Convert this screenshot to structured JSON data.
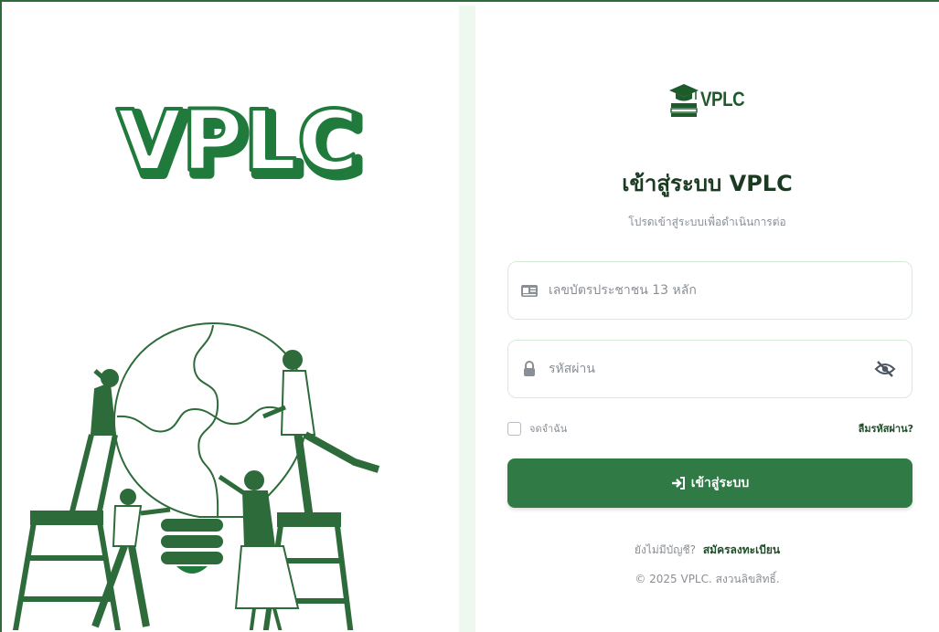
{
  "illustration": {
    "wordmark": "VPLC"
  },
  "brand": {
    "name": "VPLC",
    "accent_color": "#2f7a45",
    "dark_green": "#1d5b2a"
  },
  "login": {
    "title": "เข้าสู่ระบบ VPLC",
    "subtitle": "โปรดเข้าสู่ระบบเพื่อดำเนินการต่อ",
    "id_placeholder": "เลขบัตรประชาชน 13 หลัก",
    "password_placeholder": "รหัสผ่าน",
    "remember_label": "จดจำฉัน",
    "forgot_label": "ลืมรหัสผ่าน?",
    "submit_label": "เข้าสู่ระบบ",
    "no_account_text": "ยังไม่มีบัญชี?",
    "register_link": "สมัครลงทะเบียน",
    "copyright": "© 2025 VPLC. สงวนลิขสิทธิ์."
  },
  "icons": {
    "brand": "graduation-cap-book-icon",
    "id_field": "id-card-icon",
    "password_field": "lock-icon",
    "toggle_password": "eye-slash-icon",
    "submit": "sign-in-icon"
  }
}
